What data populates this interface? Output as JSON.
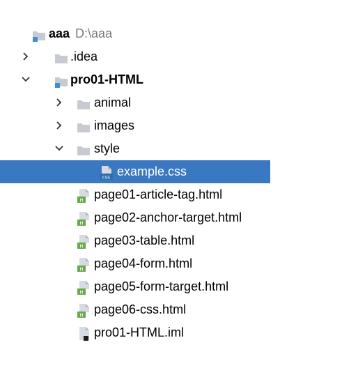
{
  "tree": {
    "root": {
      "name": "aaa",
      "path": "D:\\aaa"
    },
    "items": [
      {
        "label": ".idea"
      },
      {
        "label": "pro01-HTML"
      },
      {
        "label": "animal"
      },
      {
        "label": "images"
      },
      {
        "label": "style"
      },
      {
        "label": "example.css"
      },
      {
        "label": "page01-article-tag.html"
      },
      {
        "label": "page02-anchor-target.html"
      },
      {
        "label": "page03-table.html"
      },
      {
        "label": "page04-form.html"
      },
      {
        "label": "page05-form-target.html"
      },
      {
        "label": "page06-css.html"
      },
      {
        "label": "pro01-HTML.iml"
      }
    ]
  },
  "colors": {
    "selection": "#3b78c2",
    "folder": "#c7cbd1",
    "module_badge": "#3a8fd8",
    "html_badge": "#6aa84f"
  }
}
